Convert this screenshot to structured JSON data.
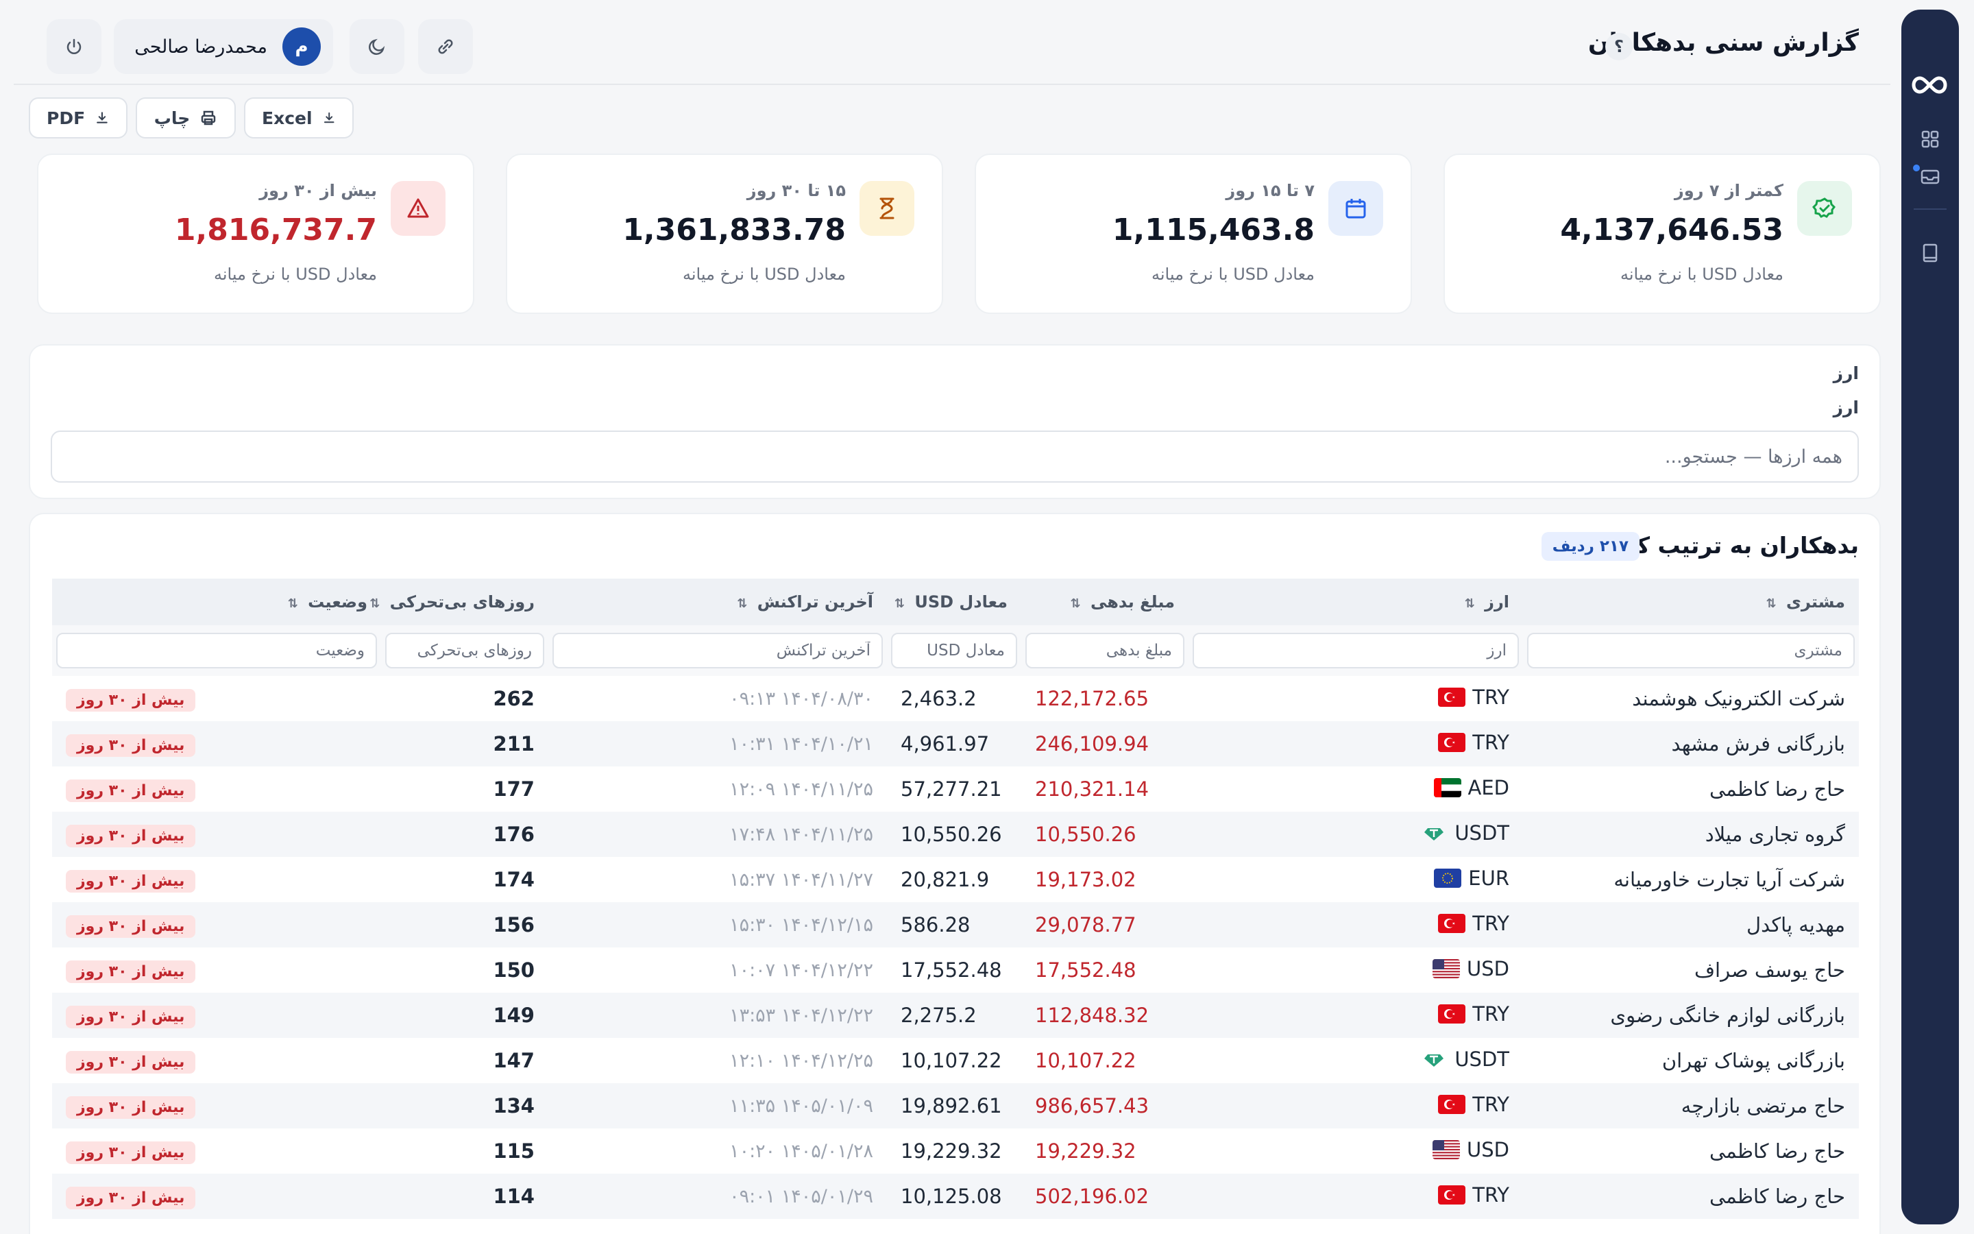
{
  "app": {
    "title": "گزارش سنی بدهکاران",
    "help_label": "؟",
    "user_name": "محمدرضا صالحی",
    "user_initial": "م"
  },
  "sidebar": {
    "logo_icon": "infinity-icon",
    "items": [
      {
        "icon": "dashboard-grid-icon"
      },
      {
        "icon": "report-inbox-icon",
        "active_dot": true
      },
      {
        "icon": "book-icon"
      }
    ]
  },
  "header_buttons": [
    {
      "icon": "power-icon"
    },
    {
      "icon": "moon-icon"
    },
    {
      "icon": "link-icon"
    }
  ],
  "toolbar": {
    "excel_label": "Excel",
    "print_label": "چاپ",
    "pdf_label": "PDF"
  },
  "cards": [
    {
      "label": "کمتر از ۷ روز",
      "value": "4,137,646.53",
      "sub": "معادل USD با نرخ میانه",
      "icon": "check-badge-icon",
      "color": "#16a34a",
      "bg": "#e6f6ec"
    },
    {
      "label": "۷ تا ۱۵ روز",
      "value": "1,115,463.8",
      "sub": "معادل USD با نرخ میانه",
      "icon": "calendar-icon",
      "color": "#2563eb",
      "bg": "#e6eefc"
    },
    {
      "label": "۱۵ تا ۳۰ روز",
      "value": "1,361,833.78",
      "sub": "معادل USD با نرخ میانه",
      "icon": "hourglass-icon",
      "color": "#b45309",
      "bg": "#fdf3d7"
    },
    {
      "label": "بیش از ۳۰ روز",
      "value": "1,816,737.7",
      "sub": "معادل USD با نرخ میانه",
      "icon": "warning-icon",
      "color": "#c0262d",
      "bg": "#fde4e4"
    }
  ],
  "filter": {
    "title": "ارز",
    "label": "ارز",
    "placeholder": "همه ارزها — جستجو..."
  },
  "table": {
    "title": "بدهکاران به ترتیب کهنگی",
    "row_count": "۲۱۷ ردیف",
    "columns": [
      "مشتری",
      "ارز",
      "مبلغ بدهی",
      "معادل USD",
      "آخرین تراکنش",
      "روزهای بی‌تحرکی",
      "وضعیت"
    ],
    "filters": [
      "مشتری",
      "ارز",
      "مبلغ بدهی",
      "معادل USD",
      "آخرین تراکنش",
      "روزهای بی‌تحرکی",
      "وضعیت"
    ],
    "rows": [
      {
        "name": "شرکت الکترونیک هوشمند",
        "currency": "TRY",
        "flag": "tr",
        "amount": "122,172.65",
        "usd": "2,463.2",
        "date": "۱۴۰۴/۰۸/۳۰ ۰۹:۱۳",
        "days": "262",
        "status": "بیش از ۳۰ روز"
      },
      {
        "name": "بازرگانی فرش مشهد",
        "currency": "TRY",
        "flag": "tr",
        "amount": "246,109.94",
        "usd": "4,961.97",
        "date": "۱۴۰۴/۱۰/۲۱ ۱۰:۳۱",
        "days": "211",
        "status": "بیش از ۳۰ روز"
      },
      {
        "name": "حاج رضا کاظمی",
        "currency": "AED",
        "flag": "ae",
        "amount": "210,321.14",
        "usd": "57,277.21",
        "date": "۱۴۰۴/۱۱/۲۵ ۱۲:۰۹",
        "days": "177",
        "status": "بیش از ۳۰ روز"
      },
      {
        "name": "گروه تجاری میلاد",
        "currency": "USDT",
        "flag": "usdt",
        "amount": "10,550.26",
        "usd": "10,550.26",
        "date": "۱۴۰۴/۱۱/۲۵ ۱۷:۴۸",
        "days": "176",
        "status": "بیش از ۳۰ روز"
      },
      {
        "name": "شرکت آریا تجارت خاورمیانه",
        "currency": "EUR",
        "flag": "eu",
        "amount": "19,173.02",
        "usd": "20,821.9",
        "date": "۱۴۰۴/۱۱/۲۷ ۱۵:۳۷",
        "days": "174",
        "status": "بیش از ۳۰ روز"
      },
      {
        "name": "مهدیه پاکدل",
        "currency": "TRY",
        "flag": "tr",
        "amount": "29,078.77",
        "usd": "586.28",
        "date": "۱۴۰۴/۱۲/۱۵ ۱۵:۳۰",
        "days": "156",
        "status": "بیش از ۳۰ روز"
      },
      {
        "name": "حاج یوسف صراف",
        "currency": "USD",
        "flag": "us",
        "amount": "17,552.48",
        "usd": "17,552.48",
        "date": "۱۴۰۴/۱۲/۲۲ ۱۰:۰۷",
        "days": "150",
        "status": "بیش از ۳۰ روز"
      },
      {
        "name": "بازرگانی لوازم خانگی رضوی",
        "currency": "TRY",
        "flag": "tr",
        "amount": "112,848.32",
        "usd": "2,275.2",
        "date": "۱۴۰۴/۱۲/۲۲ ۱۳:۵۳",
        "days": "149",
        "status": "بیش از ۳۰ روز"
      },
      {
        "name": "بازرگانی پوشاک تهران",
        "currency": "USDT",
        "flag": "usdt",
        "amount": "10,107.22",
        "usd": "10,107.22",
        "date": "۱۴۰۴/۱۲/۲۵ ۱۲:۱۰",
        "days": "147",
        "status": "بیش از ۳۰ روز"
      },
      {
        "name": "حاج مرتضی بازارچه",
        "currency": "TRY",
        "flag": "tr",
        "amount": "986,657.43",
        "usd": "19,892.61",
        "date": "۱۴۰۵/۰۱/۰۹ ۱۱:۳۵",
        "days": "134",
        "status": "بیش از ۳۰ روز"
      },
      {
        "name": "حاج رضا کاظمی",
        "currency": "USD",
        "flag": "us",
        "amount": "19,229.32",
        "usd": "19,229.32",
        "date": "۱۴۰۵/۰۱/۲۸ ۱۰:۲۰",
        "days": "115",
        "status": "بیش از ۳۰ روز"
      },
      {
        "name": "حاج رضا کاظمی",
        "currency": "TRY",
        "flag": "tr",
        "amount": "502,196.02",
        "usd": "10,125.08",
        "date": "۱۴۰۵/۰۱/۲۹ ۰۹:۰۱",
        "days": "114",
        "status": "بیش از ۳۰ روز"
      }
    ]
  },
  "colors": {
    "accent": "#1d4eab",
    "danger": "#c0262d",
    "sidebar": "#1e2a4a"
  }
}
